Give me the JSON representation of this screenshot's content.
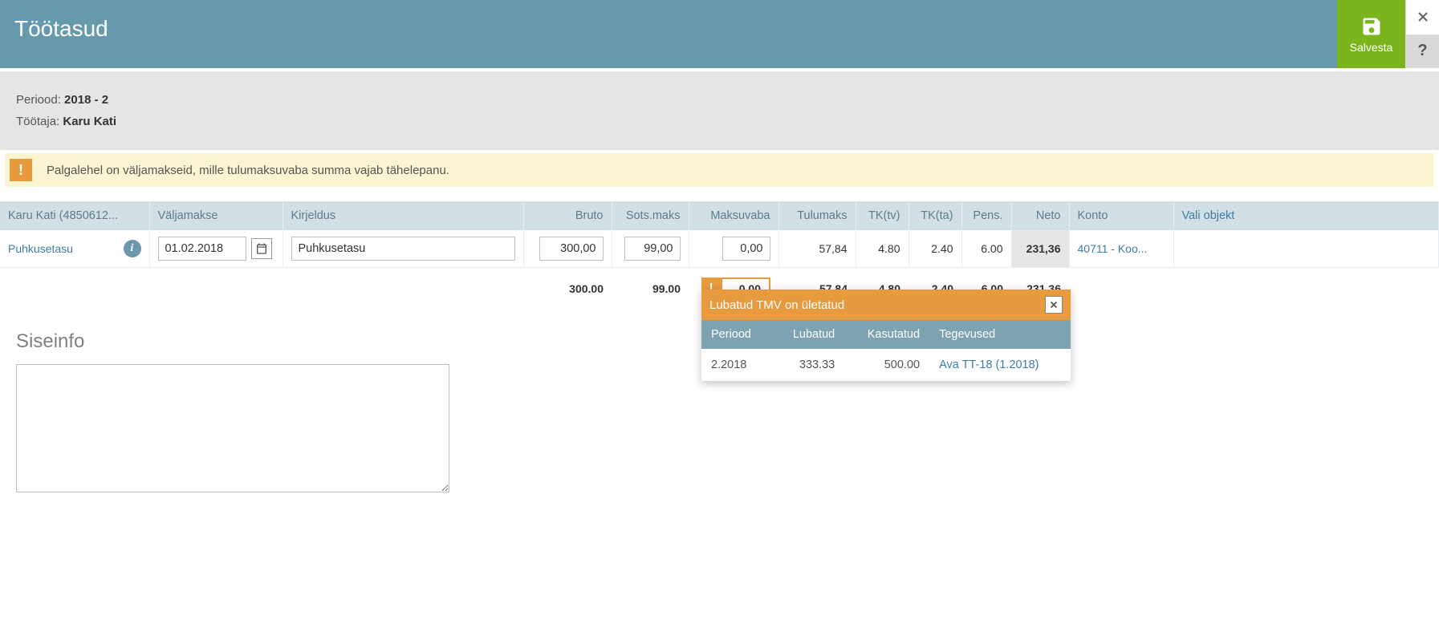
{
  "header": {
    "title": "Töötasud",
    "save_label": "Salvesta",
    "help_label": "?"
  },
  "info": {
    "period_label": "Periood:",
    "period_value": "2018 - 2",
    "worker_label": "Töötaja:",
    "worker_value": "Karu Kati"
  },
  "alert": {
    "text": "Palgalehel on väljamakseid, mille tulumaksuvaba summa vajab tähelepanu."
  },
  "grid": {
    "headers": {
      "name": "Karu Kati (4850612...",
      "payout": "Väljamakse",
      "desc": "Kirjeldus",
      "bruto": "Bruto",
      "sots": "Sots.maks",
      "maksuvaba": "Maksuvaba",
      "tulumaks": "Tulumaks",
      "tktv": "TK(tv)",
      "tkta": "TK(ta)",
      "pens": "Pens.",
      "neto": "Neto",
      "konto": "Konto",
      "objekt": "Vali objekt"
    },
    "row": {
      "name": "Puhkusetasu",
      "date": "01.02.2018",
      "desc": "Puhkusetasu",
      "bruto": "300,00",
      "sots": "99,00",
      "maksuvaba": "0,00",
      "tulumaks": "57,84",
      "tktv": "4.80",
      "tkta": "2.40",
      "pens": "6.00",
      "neto": "231,36",
      "konto": "40711 - Koo..."
    },
    "totals": {
      "bruto": "300.00",
      "sots": "99.00",
      "maksuvaba": "0.00",
      "tulumaks": "57.84",
      "tktv": "4.80",
      "tkta": "2.40",
      "pens": "6.00",
      "neto": "231.36"
    }
  },
  "popup": {
    "title": "Lubatud TMV on ületatud",
    "headers": {
      "periood": "Periood",
      "lubatud": "Lubatud",
      "kasutatud": "Kasutatud",
      "tegevused": "Tegevused"
    },
    "row": {
      "periood": "2.2018",
      "lubatud": "333.33",
      "kasutatud": "500.00",
      "link": "Ava TT-18 (1.2018)"
    }
  },
  "siseinfo": {
    "title": "Siseinfo",
    "value": ""
  }
}
